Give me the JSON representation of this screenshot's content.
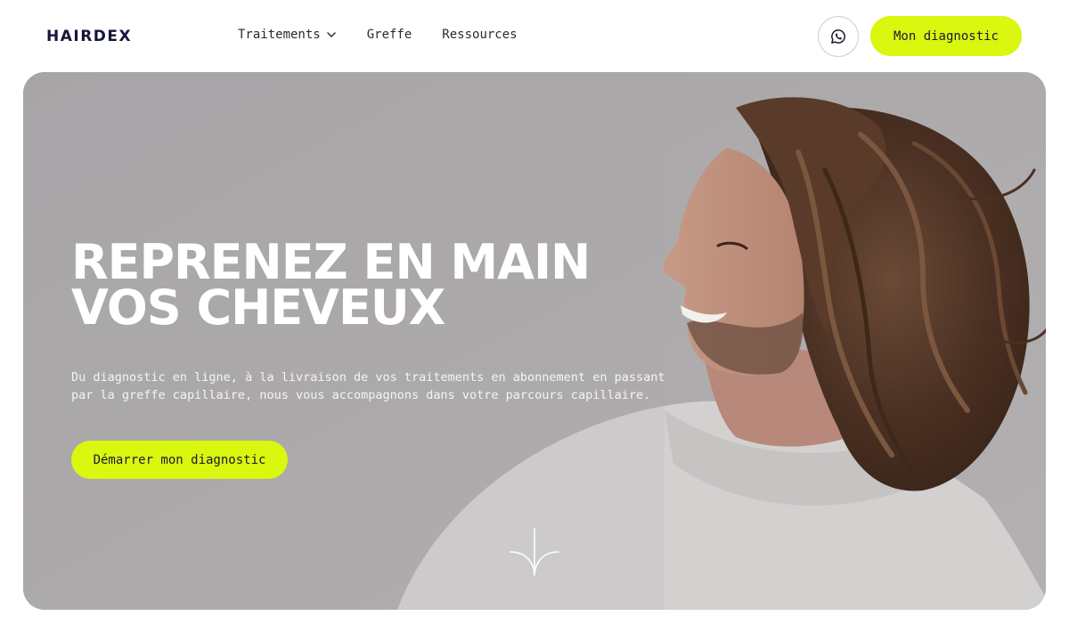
{
  "header": {
    "logo": "HAIRDEX",
    "nav": [
      {
        "label": "Traitements",
        "has_dropdown": true
      },
      {
        "label": "Greffe"
      },
      {
        "label": "Ressources"
      }
    ],
    "whatsapp_icon": "whatsapp-icon",
    "cta_label": "Mon diagnostic"
  },
  "hero": {
    "title_line1": "REPRENEZ EN MAIN",
    "title_line2": "VOS CHEVEUX",
    "subtitle_line1": "Du diagnostic en ligne, à la livraison de vos traitements en abonnement en passant",
    "subtitle_line2": "par la greffe capillaire, nous vous accompagnons dans votre parcours capillaire.",
    "cta_label": "Démarrer mon diagnostic",
    "scroll_icon": "scroll-down-arrow-icon"
  },
  "colors": {
    "accent": "#d9f70f",
    "logo": "#15163a",
    "hero_bg": "#aaa7a9",
    "text_light": "#ffffff"
  }
}
